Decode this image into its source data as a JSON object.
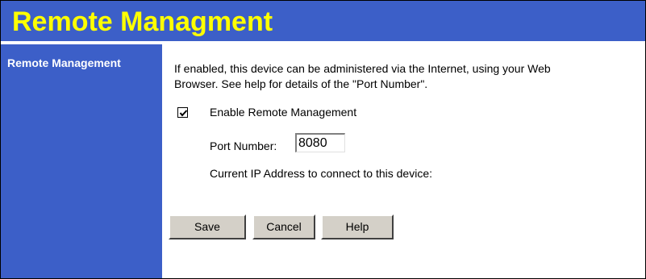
{
  "page": {
    "title": "Remote Managment"
  },
  "sidebar": {
    "label": "Remote Management"
  },
  "content": {
    "description_line1": "If enabled, this device can be administered via the Internet, using your Web",
    "description_line2": "Browser. See help for details of the \"Port Number\".",
    "enable_checkbox": {
      "label": "Enable Remote Management",
      "checked": true
    },
    "port": {
      "label": "Port Number:",
      "value": "8080"
    },
    "ip_label": "Current IP Address to connect to this device:"
  },
  "buttons": {
    "save": "Save",
    "cancel": "Cancel",
    "help": "Help"
  },
  "colors": {
    "header_bg": "#3c5fc8",
    "title_text": "#ffff00",
    "sidebar_text": "#ffffff",
    "button_face": "#d4d0c8"
  }
}
